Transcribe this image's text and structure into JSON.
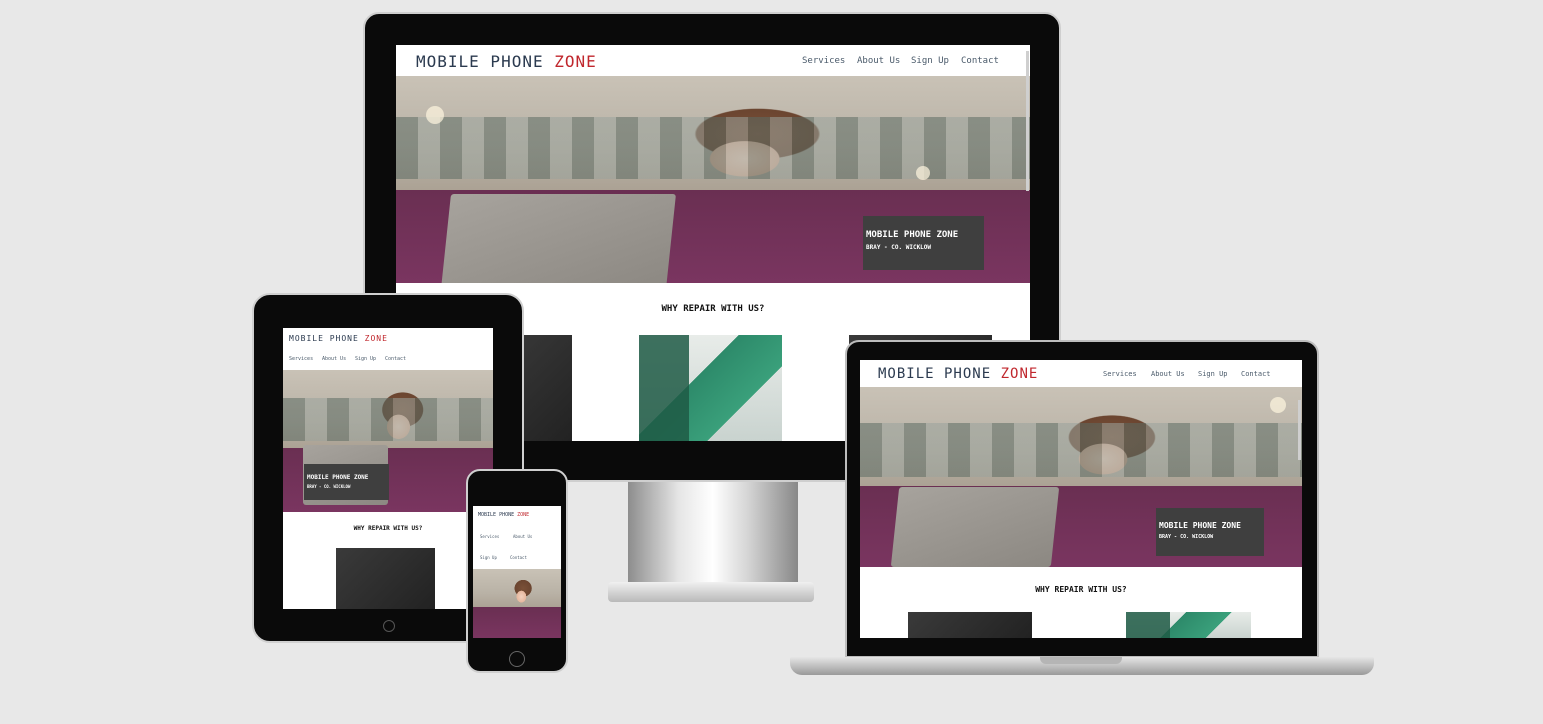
{
  "site": {
    "logo_main": "MOBILE PHONE",
    "logo_accent": "ZONE",
    "nav": [
      "Services",
      "About Us",
      "Sign Up",
      "Contact"
    ],
    "hero_title": "MOBILE PHONE ZONE",
    "hero_subtitle": "BRAY - CO. WICKLOW",
    "why_heading": "WHY REPAIR WITH US?"
  },
  "colors": {
    "logo": "#2b3a4f",
    "accent": "#c0272d",
    "background": "#e8e8e8",
    "bezel": "#0a0a0a"
  }
}
